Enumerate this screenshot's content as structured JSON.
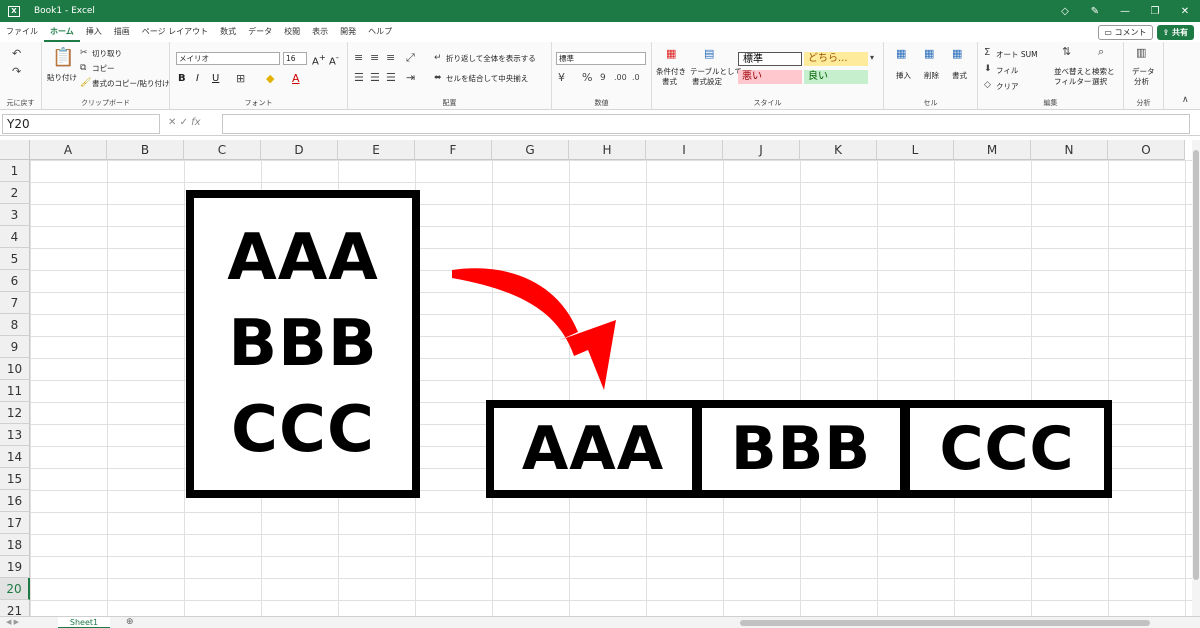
{
  "window": {
    "title": "Book1 - Excel",
    "app_icon": "excel-icon"
  },
  "tabs": [
    "ファイル",
    "ホーム",
    "挿入",
    "描画",
    "ページ レイアウト",
    "数式",
    "データ",
    "校閲",
    "表示",
    "開発",
    "ヘルプ"
  ],
  "active_tab": "ホーム",
  "tab_bar": {
    "comment_label": "コメント",
    "share_label": "共有"
  },
  "ribbon": {
    "undo_group": {
      "label": "元に戻す"
    },
    "clipboard": {
      "label": "クリップボード",
      "paste": "貼り付け",
      "cut": "切り取り",
      "copy": "コピー",
      "format_painter": "書式のコピー/貼り付け"
    },
    "font": {
      "label": "フォント",
      "font_name": "メイリオ",
      "font_size": "16"
    },
    "alignment": {
      "label": "配置",
      "wrap_text": "折り返して全体を表示する",
      "merge_center": "セルを結合して中央揃え"
    },
    "number": {
      "label": "数値",
      "format": "標準"
    },
    "styles": {
      "label": "スタイル",
      "conditional_1": "条件付き",
      "conditional_2": "書式",
      "as_table_1": "テーブルとして",
      "as_table_2": "書式設定",
      "cells": [
        {
          "text": "標準",
          "bg": "#ffffff",
          "fg": "#000000"
        },
        {
          "text": "どちら...",
          "bg": "#ffeb9c",
          "fg": "#9c5700"
        },
        {
          "text": "悪い",
          "bg": "#ffc7ce",
          "fg": "#9c0006"
        },
        {
          "text": "良い",
          "bg": "#c6efce",
          "fg": "#006100"
        }
      ]
    },
    "cells_group": {
      "label": "セル",
      "insert": "挿入",
      "delete": "削除",
      "format": "書式"
    },
    "editing": {
      "label": "編集",
      "autosum": "オート SUM",
      "fill": "フィル",
      "clear": "クリア",
      "sort_1": "並べ替えと",
      "sort_2": "フィルター",
      "find_1": "検索と",
      "find_2": "選択"
    },
    "analysis": {
      "label": "分析",
      "data_analysis_1": "データ",
      "data_analysis_2": "分析"
    }
  },
  "formula_bar": {
    "name_box": "Y20",
    "fx": "fx",
    "formula": ""
  },
  "columns": [
    "A",
    "B",
    "C",
    "D",
    "E",
    "F",
    "G",
    "H",
    "I",
    "J",
    "K",
    "L",
    "M",
    "N",
    "O"
  ],
  "rows": [
    "1",
    "2",
    "3",
    "4",
    "5",
    "6",
    "7",
    "8",
    "9",
    "10",
    "11",
    "12",
    "13",
    "14",
    "15",
    "16",
    "17",
    "18",
    "19",
    "20",
    "21"
  ],
  "active_row": "20",
  "illustration": {
    "vertical": [
      "AAA",
      "BBB",
      "CCC"
    ],
    "horizontal": [
      "AAA",
      "BBB",
      "CCC"
    ],
    "arrow_color": "#ff0000"
  },
  "sheets": {
    "tabs": [
      "Sheet1"
    ],
    "active": "Sheet1"
  },
  "colors": {
    "accent": "#1e7a45"
  }
}
